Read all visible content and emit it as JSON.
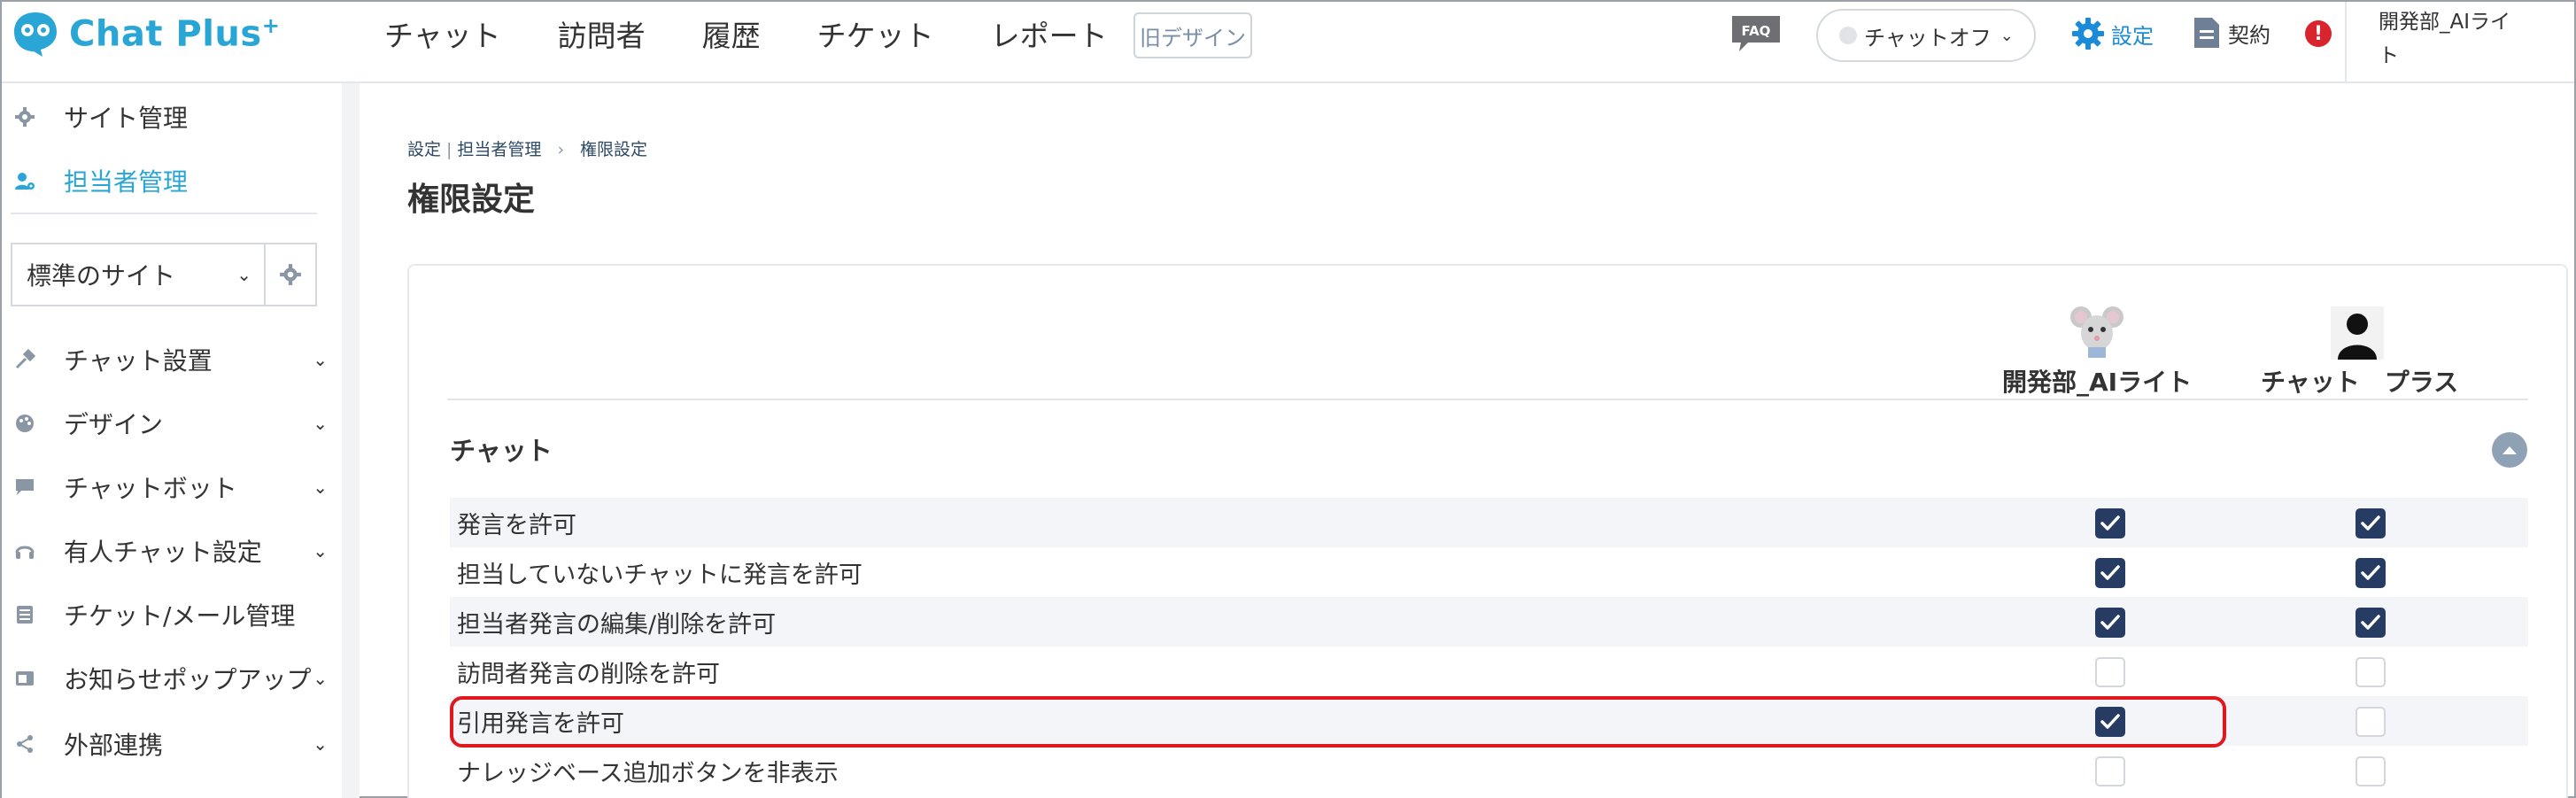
{
  "header": {
    "logo_text": "Chat Plus",
    "logo_plus": "+",
    "nav": [
      "チャット",
      "訪問者",
      "履歴",
      "チケット",
      "レポート"
    ],
    "old_design": "旧デザイン",
    "faq": "FAQ",
    "chat_status": "チャットオフ",
    "settings": "設定",
    "contract": "契約",
    "alert": "!",
    "user_name_1": "開発部_AIライ",
    "user_name_2": "ト"
  },
  "sidebar": {
    "site_manage": "サイト管理",
    "staff_manage": "担当者管理",
    "site_select": "標準のサイト",
    "items": [
      {
        "label": "チャット設置",
        "icon": "wrench-icon",
        "expandable": true
      },
      {
        "label": "デザイン",
        "icon": "palette-icon",
        "expandable": true
      },
      {
        "label": "チャットボット",
        "icon": "chat-bubble-icon",
        "expandable": true
      },
      {
        "label": "有人チャット設定",
        "icon": "headset-icon",
        "expandable": true
      },
      {
        "label": "チケット/メール管理",
        "icon": "list-icon",
        "expandable": false
      },
      {
        "label": "お知らせポップアップ",
        "icon": "popup-icon",
        "expandable": true
      },
      {
        "label": "外部連携",
        "icon": "share-icon",
        "expandable": true
      }
    ]
  },
  "main": {
    "breadcrumb": {
      "a": "設定",
      "b": "担当者管理",
      "sep": "›",
      "c": "権限設定"
    },
    "title": "権限設定",
    "columns": [
      "開発部_AIライト",
      "チャット　プラス"
    ],
    "section": "チャット",
    "rows": [
      {
        "label": "発言を許可",
        "col1": true,
        "col2": true
      },
      {
        "label": "担当していないチャットに発言を許可",
        "col1": true,
        "col2": true
      },
      {
        "label": "担当者発言の編集/削除を許可",
        "col1": true,
        "col2": true
      },
      {
        "label": "訪問者発言の削除を許可",
        "col1": false,
        "col2": false
      },
      {
        "label": "引用発言を許可",
        "col1": true,
        "col2": false
      },
      {
        "label": "ナレッジベース追加ボタンを非表示",
        "col1": false,
        "col2": false
      }
    ]
  },
  "colors": {
    "accent": "#2aa6d6",
    "link": "#1a8bd8",
    "checkbox": "#273c63",
    "highlight": "#e0191f",
    "alert": "#d9232d"
  }
}
